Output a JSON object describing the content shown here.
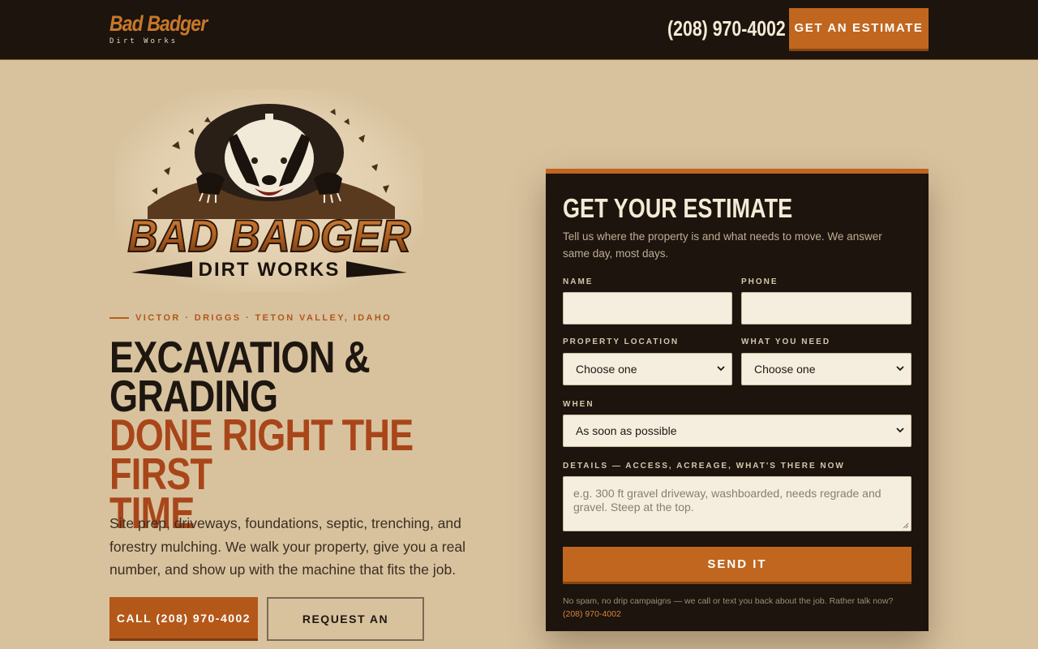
{
  "header": {
    "brand_name": "Bad Badger",
    "brand_sub": "Dirt Works",
    "phone": "(208) 970-4002",
    "cta": "GET AN ESTIMATE"
  },
  "logo": {
    "wordmark": "BAD BADGER",
    "sub": "DIRT WORKS"
  },
  "hero": {
    "eyebrow": "VICTOR · DRIGGS · TETON VALLEY, IDAHO",
    "headline_line1": "EXCAVATION &",
    "headline_line2": "GRADING",
    "headline_line3": "DONE RIGHT THE FIRST",
    "headline_line4": "TIME",
    "lede": "Site prep, driveways, foundations, septic, trenching, and forestry mulching. We walk your property, give you a real number, and show up with the machine that fits the job.",
    "call_button": "CALL (208) 970-4002",
    "request_button": "REQUEST AN ESTIMATE"
  },
  "form": {
    "title": "GET YOUR ESTIMATE",
    "subtitle": "Tell us where the property is and what needs to move. We answer same day, most days.",
    "name_label": "NAME",
    "name_value": "",
    "phone_label": "PHONE",
    "phone_value": "",
    "location_label": "PROPERTY LOCATION",
    "location_value": "Choose one",
    "need_label": "WHAT YOU NEED",
    "need_value": "Choose one",
    "when_label": "WHEN",
    "when_value": "As soon as possible",
    "details_label": "DETAILS — ACCESS, ACREAGE, WHAT'S THERE NOW",
    "details_placeholder": "e.g. 300 ft gravel driveway, washboarded, needs regrade and gravel. Steep at the top.",
    "submit": "SEND IT",
    "fine_print": "No spam, no drip campaigns — we call or text you back about the job. Rather talk now?",
    "fine_phone": "(208) 970-4002"
  },
  "colors": {
    "page_bg": "#d8c29e",
    "header_bg": "#1c140d",
    "accent": "#c0661f",
    "headline_accent": "#a8461a"
  }
}
